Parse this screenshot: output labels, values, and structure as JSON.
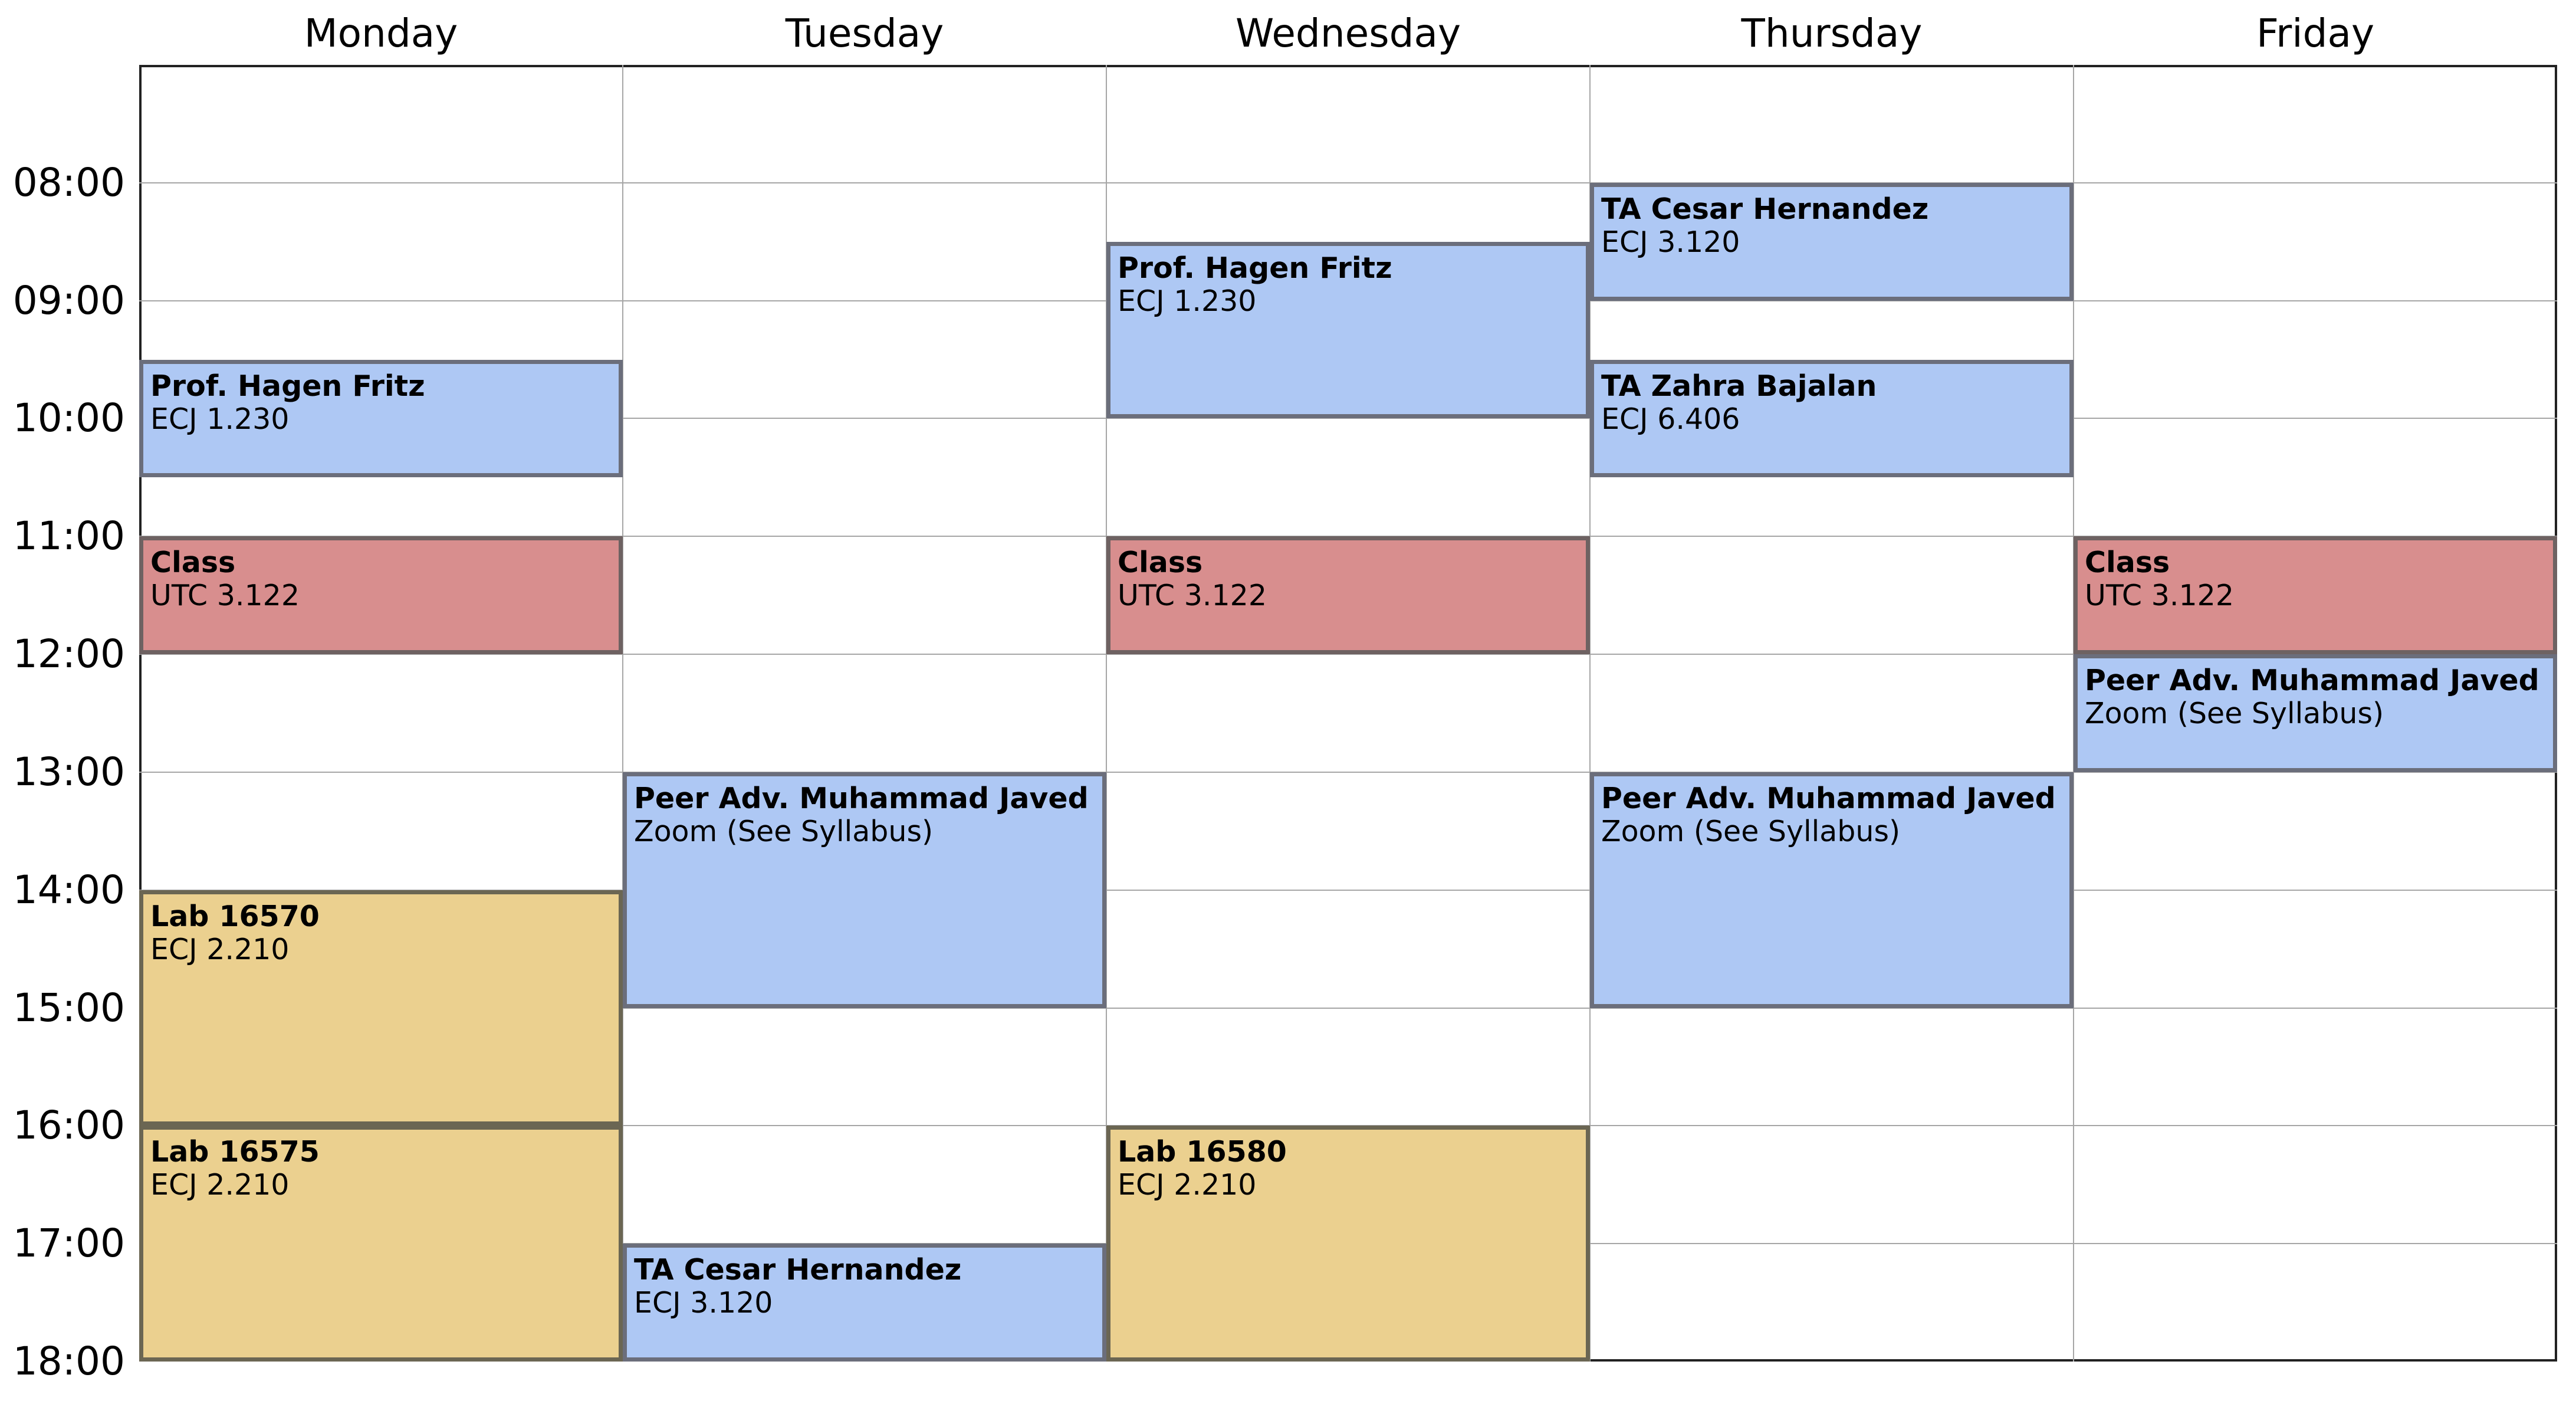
{
  "days": [
    "Monday",
    "Tuesday",
    "Wednesday",
    "Thursday",
    "Friday"
  ],
  "times": [
    "08:00",
    "09:00",
    "10:00",
    "11:00",
    "12:00",
    "13:00",
    "14:00",
    "15:00",
    "16:00",
    "17:00",
    "18:00"
  ],
  "colors": {
    "office_hours": "#aec8f4",
    "class": "#d88e8e",
    "lab": "#ebd08f",
    "gridline": "#a6a6a6"
  },
  "events": [
    {
      "day": "Monday",
      "start": "09:30",
      "end": "10:30",
      "kind": "office",
      "title": "Prof. Hagen Fritz",
      "location": "ECJ 1.230"
    },
    {
      "day": "Monday",
      "start": "11:00",
      "end": "12:00",
      "kind": "class",
      "title": "Class",
      "location": "UTC 3.122"
    },
    {
      "day": "Monday",
      "start": "14:00",
      "end": "16:00",
      "kind": "lab",
      "title": "Lab 16570",
      "location": "ECJ 2.210"
    },
    {
      "day": "Monday",
      "start": "16:00",
      "end": "18:00",
      "kind": "lab",
      "title": "Lab 16575",
      "location": "ECJ 2.210"
    },
    {
      "day": "Tuesday",
      "start": "13:00",
      "end": "15:00",
      "kind": "office",
      "title": "Peer Adv. Muhammad Javed",
      "location": "Zoom (See Syllabus)"
    },
    {
      "day": "Tuesday",
      "start": "17:00",
      "end": "18:00",
      "kind": "office",
      "title": "TA Cesar Hernandez",
      "location": "ECJ 3.120"
    },
    {
      "day": "Wednesday",
      "start": "08:30",
      "end": "10:00",
      "kind": "office",
      "title": "Prof. Hagen Fritz",
      "location": "ECJ 1.230"
    },
    {
      "day": "Wednesday",
      "start": "11:00",
      "end": "12:00",
      "kind": "class",
      "title": "Class",
      "location": "UTC 3.122"
    },
    {
      "day": "Wednesday",
      "start": "16:00",
      "end": "18:00",
      "kind": "lab",
      "title": "Lab 16580",
      "location": "ECJ 2.210"
    },
    {
      "day": "Thursday",
      "start": "08:00",
      "end": "09:00",
      "kind": "office",
      "title": "TA Cesar Hernandez",
      "location": "ECJ 3.120"
    },
    {
      "day": "Thursday",
      "start": "09:30",
      "end": "10:30",
      "kind": "office",
      "title": "TA Zahra Bajalan",
      "location": "ECJ 6.406"
    },
    {
      "day": "Thursday",
      "start": "13:00",
      "end": "15:00",
      "kind": "office",
      "title": "Peer Adv. Muhammad Javed",
      "location": "Zoom (See Syllabus)"
    },
    {
      "day": "Friday",
      "start": "11:00",
      "end": "12:00",
      "kind": "class",
      "title": "Class",
      "location": "UTC 3.122"
    },
    {
      "day": "Friday",
      "start": "12:00",
      "end": "13:00",
      "kind": "office",
      "title": "Peer Adv. Muhammad Javed",
      "location": "Zoom (See Syllabus)"
    }
  ]
}
